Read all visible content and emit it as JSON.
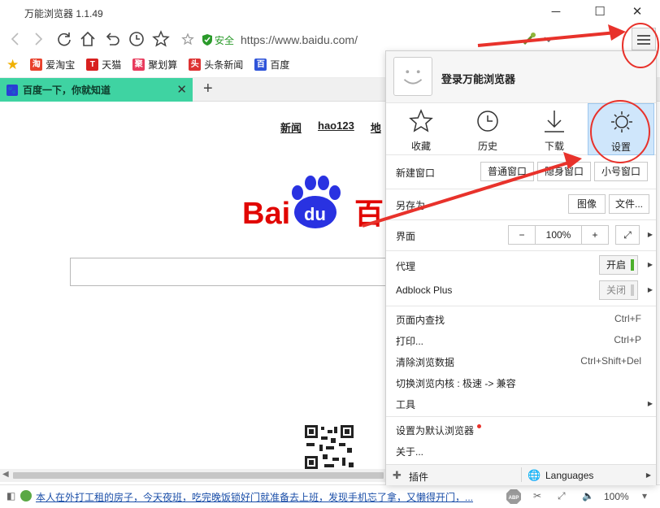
{
  "window": {
    "title": "万能浏览器 1.1.49",
    "minimize": "─",
    "maximize": "☐",
    "close": "✕"
  },
  "navbar": {
    "secure_label": "安全",
    "url": "https://www.baidu.com/"
  },
  "bookmarks": [
    {
      "label": "爱淘宝",
      "icon": "taobao-icon",
      "glyph": "淘",
      "color": "#e8412c"
    },
    {
      "label": "天猫",
      "icon": "tmall-icon",
      "glyph": "T",
      "color": "#d8201f"
    },
    {
      "label": "聚划算",
      "icon": "juhuasuan-icon",
      "glyph": "聚",
      "color": "#e83a5c"
    },
    {
      "label": "头条新闻",
      "icon": "toutiao-icon",
      "glyph": "头",
      "color": "#d33"
    },
    {
      "label": "百度",
      "icon": "baidu-paw-icon",
      "glyph": "百",
      "color": "#2f54d9"
    }
  ],
  "tab": {
    "title": "百度一下，你就知道",
    "new_tab": "+"
  },
  "page": {
    "links": [
      "新闻",
      "hao123",
      "地"
    ],
    "logo_text_left": "Bai",
    "logo_text_du": "du",
    "logo_text_right": "百"
  },
  "status": {
    "news": "本人在外打工租的房子，今天夜班，吃完晚饭锁好门就准备去上班，发现手机忘了拿，又懒得开门，...",
    "zoom": "100%"
  },
  "menu": {
    "login": "登录万能浏览器",
    "quick": [
      {
        "label": "收藏",
        "icon": "star-icon"
      },
      {
        "label": "历史",
        "icon": "clock-icon"
      },
      {
        "label": "下载",
        "icon": "download-icon"
      },
      {
        "label": "设置",
        "icon": "settings-icon"
      }
    ],
    "new_window": "新建窗口",
    "normal_window": "普通窗口",
    "private_window": "隐身窗口",
    "small_window": "小号窗口",
    "save_as": "另存为",
    "save_image": "图像",
    "save_file": "文件...",
    "ui": "界面",
    "zoom_minus": "−",
    "zoom_value": "100%",
    "zoom_plus": "+",
    "proxy": "代理",
    "proxy_state": "开启",
    "adblock": "Adblock Plus",
    "adblock_state": "关闭",
    "find": "页面内查找",
    "find_key": "Ctrl+F",
    "print": "打印...",
    "print_key": "Ctrl+P",
    "clear": "清除浏览数据",
    "clear_key": "Ctrl+Shift+Del",
    "switch_core": "切换浏览内核 : 极速 -> 兼容",
    "tools": "工具",
    "set_default": "设置为默认浏览器",
    "about": "关于...",
    "plugins": "插件",
    "languages": "Languages"
  },
  "colors": {
    "accent_tab": "#3fd3a2",
    "annotation": "#e8322b",
    "toggle_on": "#4caf2b"
  }
}
